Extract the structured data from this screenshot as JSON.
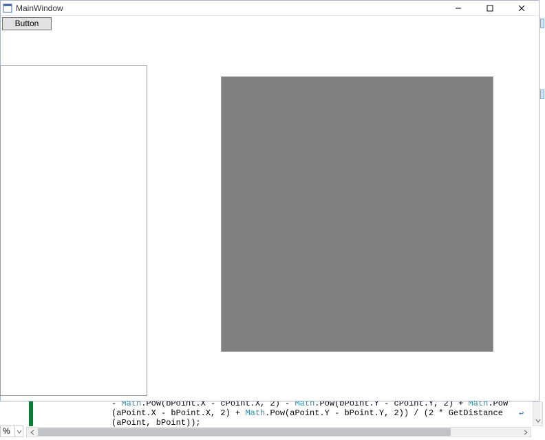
{
  "window": {
    "title": "MainWindow",
    "button_label": "Button"
  },
  "editor": {
    "code_line1_pre": "- ",
    "code_line1_type1": "Math",
    "code_line1_mid1": ".Pow(bPoint.X - cPoint.X, 2) - ",
    "code_line1_type2": "Math",
    "code_line1_mid2": ".Pow(bPoint.Y - cPoint.Y, 2) + ",
    "code_line1_type3": "Math",
    "code_line1_end": ".Pow",
    "code_line2_pre": "(aPoint.X - bPoint.X, 2) + ",
    "code_line2_type": "Math",
    "code_line2_end": ".Pow(aPoint.Y - bPoint.Y, 2)) / (2 * GetDistance",
    "code_line3": "(aPoint, bPoint));",
    "wrap_glyph": "↩"
  },
  "zoom": {
    "value": "%"
  },
  "icons": {
    "app": "app-icon",
    "minimize": "minimize-icon",
    "maximize": "maximize-icon",
    "close": "close-icon",
    "chevron_down": "chevron-down-icon",
    "arrow_left": "arrow-left-icon",
    "arrow_right": "arrow-right-icon",
    "arrow_down": "arrow-down-icon"
  },
  "colors": {
    "grey_square": "#808080",
    "gutter_green": "#0a7d3a",
    "type_token": "#2b91af"
  }
}
